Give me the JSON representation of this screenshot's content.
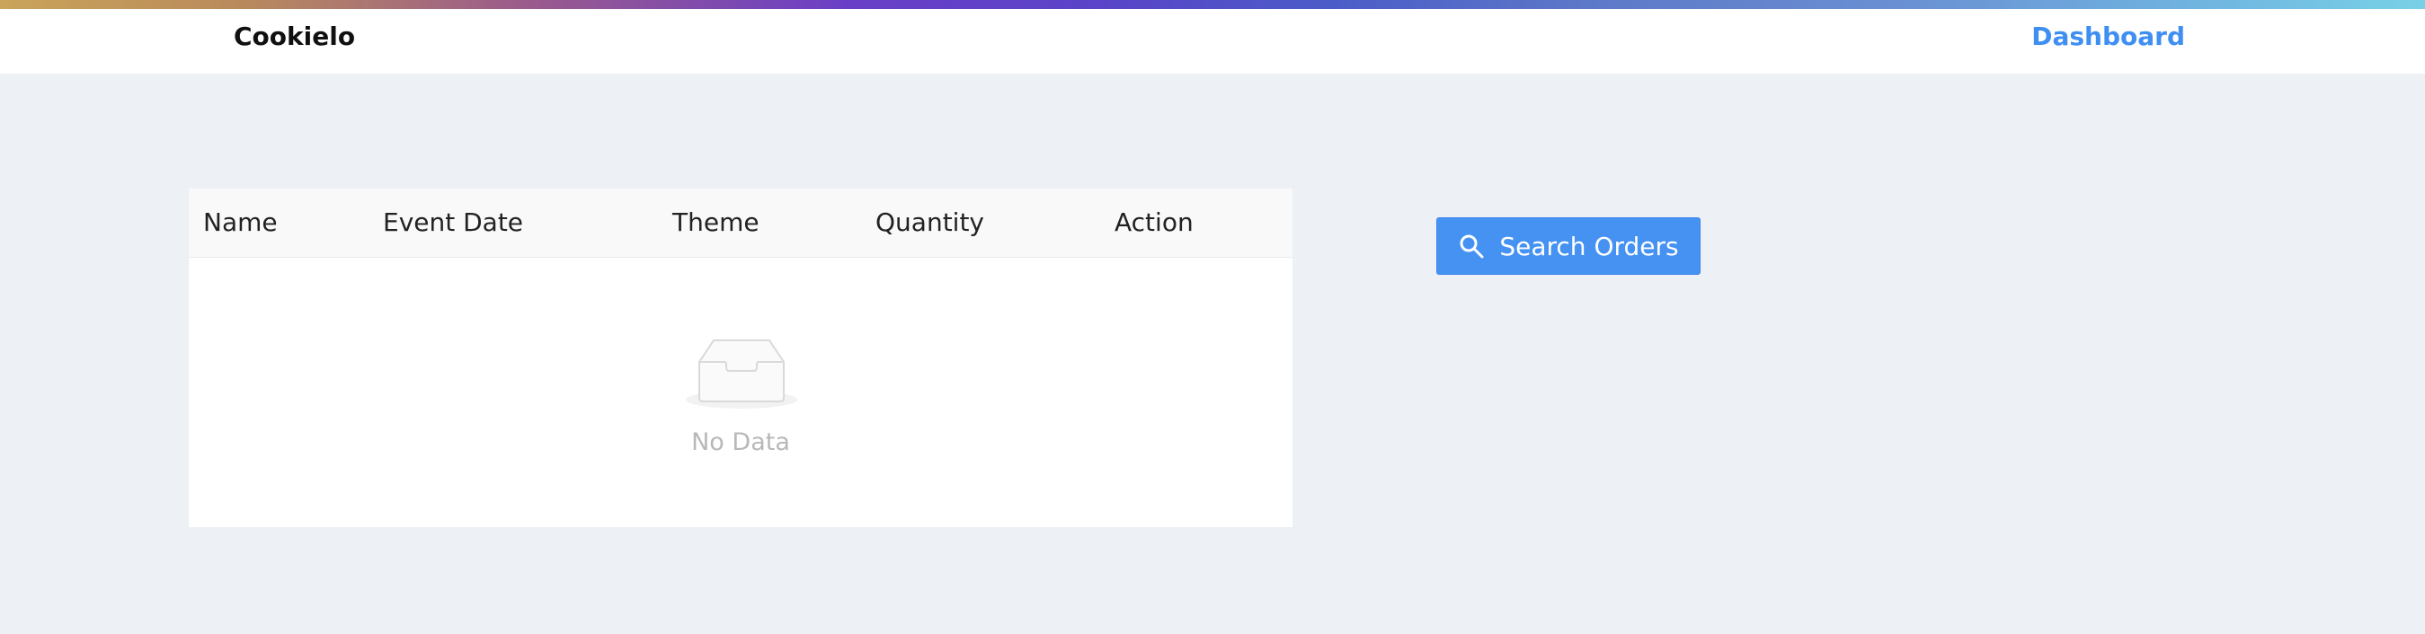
{
  "header": {
    "brand": "Cookielo",
    "nav_link": "Dashboard"
  },
  "table": {
    "columns": [
      "Name",
      "Event Date",
      "Theme",
      "Quantity",
      "Action"
    ],
    "rows": [],
    "empty_text": "No Data"
  },
  "actions": {
    "search_label": "Search Orders"
  },
  "colors": {
    "accent": "#4692f2",
    "link": "#3f8ef2",
    "background": "#edf0f5"
  },
  "icons": {
    "empty": "inbox-icon",
    "search": "search-icon"
  }
}
